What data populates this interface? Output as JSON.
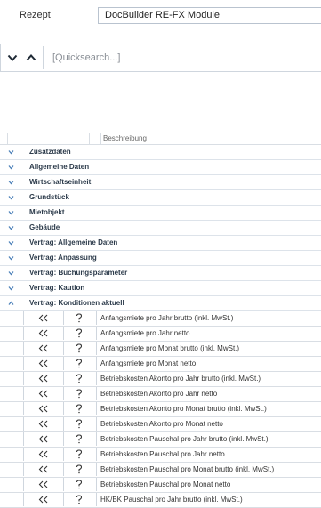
{
  "rezept": {
    "label": "Rezept",
    "value": "DocBuilder RE-FX Module"
  },
  "search": {
    "placeholder": "[Quicksearch...]"
  },
  "grid": {
    "header": "Beschreibung",
    "collapsed_groups": [
      "Zusatzdaten",
      "Allgemeine Daten",
      "Wirtschaftseinheit",
      "Grundstück",
      "Mietobjekt",
      "Gebäude",
      "Vertrag: Allgemeine Daten",
      "Vertrag: Anpassung",
      "Vertrag: Buchungsparameter",
      "Vertrag: Kaution"
    ],
    "expanded_group": "Vertrag: Konditionen aktuell",
    "rows": [
      "Anfangsmiete pro Jahr brutto (inkl. MwSt.)",
      "Anfangsmiete pro Jahr netto",
      "Anfangsmiete pro Monat brutto (inkl. MwSt.)",
      "Anfangsmiete pro Monat netto",
      "Betriebskosten Akonto pro Jahr brutto (inkl. MwSt.)",
      "Betriebskosten Akonto pro Jahr netto",
      "Betriebskosten Akonto pro Monat brutto (inkl. MwSt.)",
      "Betriebskosten Akonto pro Monat netto",
      "Betriebskosten Pauschal pro Jahr brutto (inkl. MwSt.)",
      "Betriebskosten Pauschal pro Jahr netto",
      "Betriebskosten Pauschal pro Monat brutto (inkl. MwSt.)",
      "Betriebskosten Pauschal pro Monat netto",
      "HK/BK Pauschal pro Jahr brutto (inkl. MwSt.)"
    ]
  },
  "icons": {
    "collapse": "chevron-down-icon",
    "expand": "chevron-up-icon",
    "insert": "double-chevron-left-icon",
    "help": "question-mark-icon"
  },
  "colors": {
    "accent": "#4a7fb8",
    "border": "#cfd6de"
  }
}
